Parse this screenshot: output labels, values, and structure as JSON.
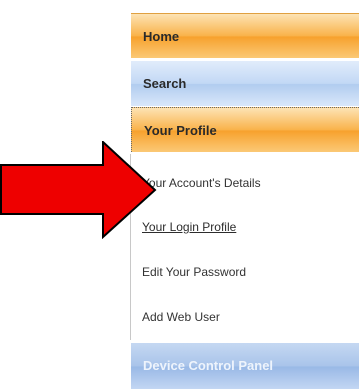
{
  "menu": {
    "home_label": "Home",
    "search_label": "Search",
    "profile_label": "Your Profile",
    "profile_items": [
      {
        "label": "Your Account's Details"
      },
      {
        "label": "Your Login Profile"
      },
      {
        "label": "Edit Your Password"
      },
      {
        "label": "Add Web User"
      }
    ],
    "device_label": "Device Control Panel"
  },
  "annotation": {
    "icon": "right-arrow-icon",
    "fill_color": "#ee0000",
    "stroke_color": "#000000"
  },
  "colors": {
    "orange_header": "#f7a12d",
    "blue_header": "#b1ccef",
    "disabled_text": "#eef4fc"
  }
}
